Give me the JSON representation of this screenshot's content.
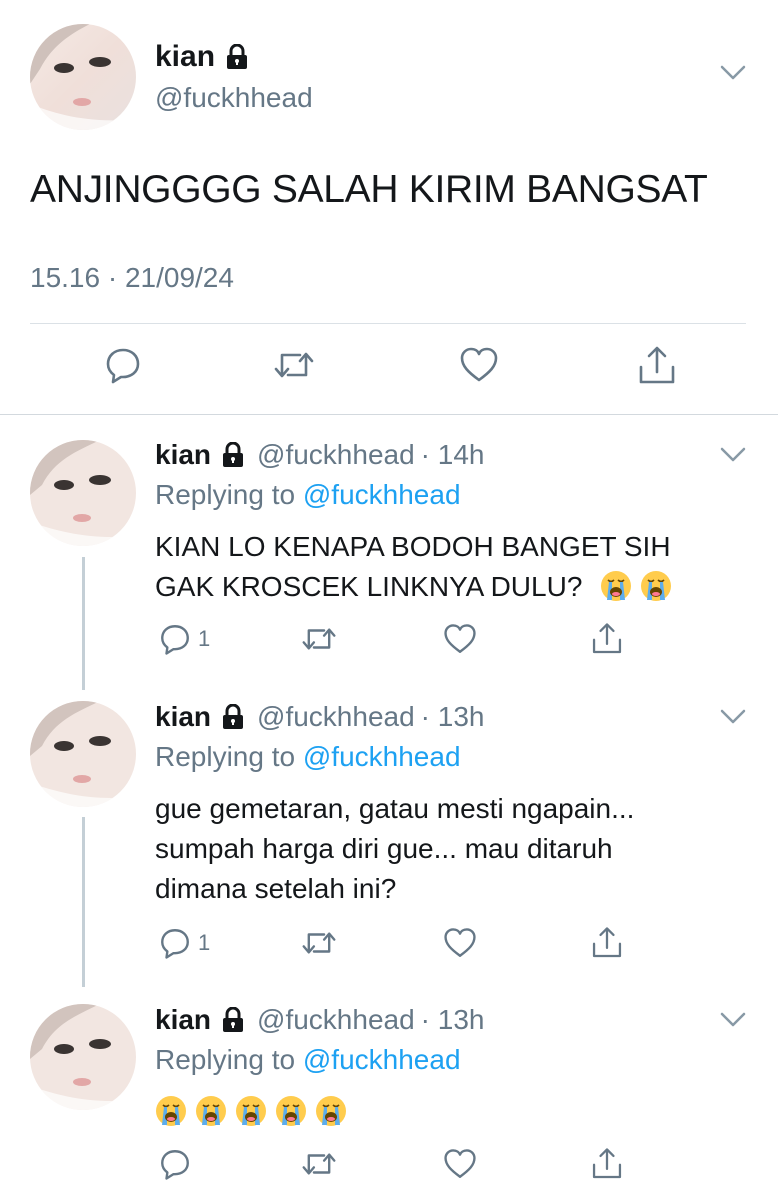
{
  "main_tweet": {
    "name": "kian",
    "handle": "@fuckhhead",
    "text": "ANJINGGGG SALAH KIRIM BANGSAT",
    "timestamp": "15.16 · 21/09/24"
  },
  "replies": [
    {
      "name": "kian",
      "handle": "@fuckhhead",
      "time": "· 14h",
      "replying_prefix": "Replying to",
      "replying_to": "@fuckhhead",
      "lines": [
        "KIAN LO KENAPA BODOH BANGET SIH",
        "GAK KROSCEK LINKNYA DULU?"
      ],
      "emoji_count": 2,
      "reply_count": "1"
    },
    {
      "name": "kian",
      "handle": "@fuckhhead",
      "time": "· 13h",
      "replying_prefix": "Replying to",
      "replying_to": "@fuckhhead",
      "lines": [
        "gue gemetaran, gatau mesti ngapain...",
        "sumpah harga diri gue... mau ditaruh",
        "dimana setelah ini?"
      ],
      "emoji_count": 0,
      "reply_count": "1"
    },
    {
      "name": "kian",
      "handle": "@fuckhhead",
      "time": "· 13h",
      "replying_prefix": "Replying to",
      "replying_to": "@fuckhhead",
      "lines": [],
      "emoji_count": 5,
      "reply_count": ""
    }
  ],
  "icons": {
    "reply": "reply-icon",
    "retweet": "retweet-icon",
    "like": "heart-icon",
    "share": "share-icon",
    "lock": "lock-icon",
    "more": "chevron-down-icon",
    "emoji": "loudly-crying-face-emoji"
  },
  "colors": {
    "text": "#14171a",
    "muted": "#657786",
    "link": "#1da1f2",
    "divider": "#dbe1e6",
    "thread_line": "#c4cfd6"
  }
}
